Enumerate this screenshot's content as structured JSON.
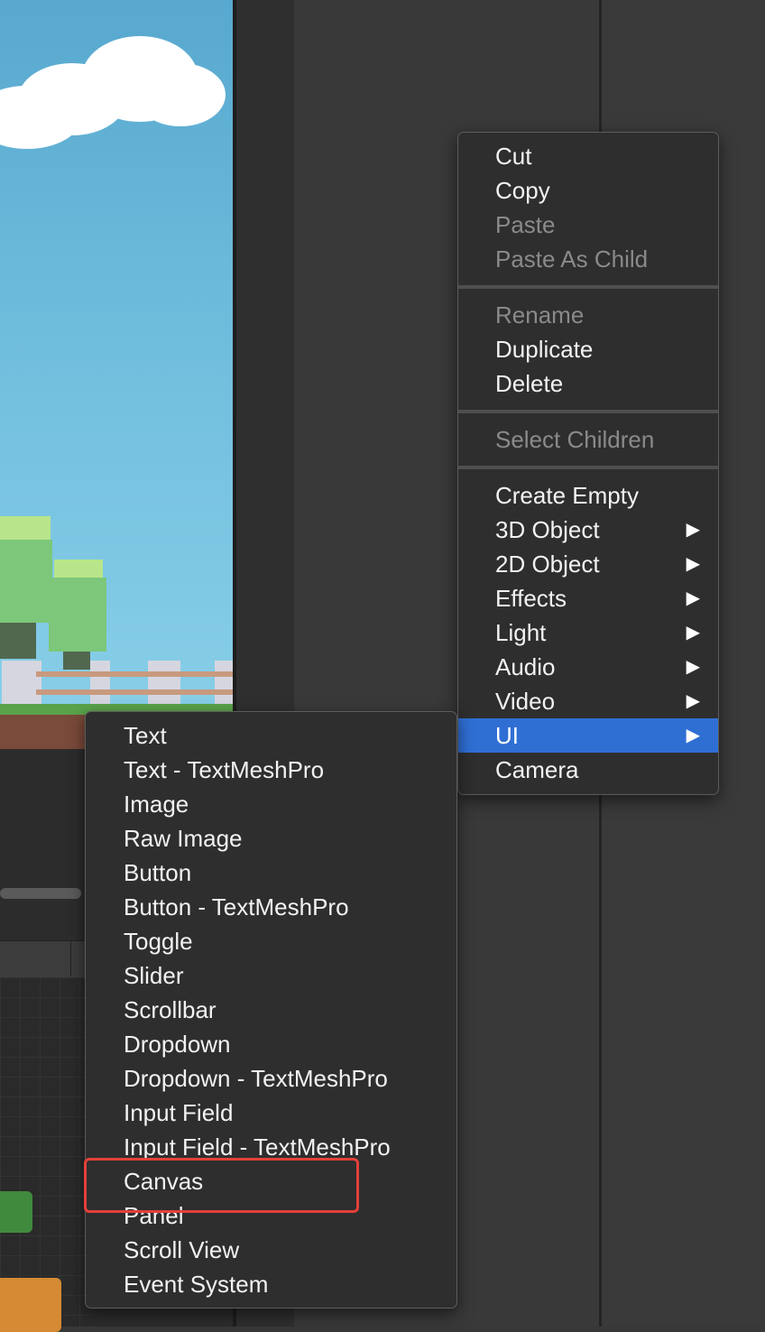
{
  "context_menu": {
    "items": [
      {
        "label": "Cut",
        "enabled": true
      },
      {
        "label": "Copy",
        "enabled": true
      },
      {
        "label": "Paste",
        "enabled": false
      },
      {
        "label": "Paste As Child",
        "enabled": false
      },
      {
        "label": "Rename",
        "enabled": false
      },
      {
        "label": "Duplicate",
        "enabled": true
      },
      {
        "label": "Delete",
        "enabled": true
      },
      {
        "label": "Select Children",
        "enabled": false
      },
      {
        "label": "Create Empty",
        "enabled": true
      },
      {
        "label": "3D Object",
        "enabled": true,
        "has_submenu": true
      },
      {
        "label": "2D Object",
        "enabled": true,
        "has_submenu": true
      },
      {
        "label": "Effects",
        "enabled": true,
        "has_submenu": true
      },
      {
        "label": "Light",
        "enabled": true,
        "has_submenu": true
      },
      {
        "label": "Audio",
        "enabled": true,
        "has_submenu": true
      },
      {
        "label": "Video",
        "enabled": true,
        "has_submenu": true
      },
      {
        "label": "UI",
        "enabled": true,
        "has_submenu": true,
        "selected": true
      },
      {
        "label": "Camera",
        "enabled": true
      }
    ],
    "submenu_arrow": "▶"
  },
  "ui_submenu": {
    "items": [
      "Text",
      "Text - TextMeshPro",
      "Image",
      "Raw Image",
      "Button",
      "Button - TextMeshPro",
      "Toggle",
      "Slider",
      "Scrollbar",
      "Dropdown",
      "Dropdown - TextMeshPro",
      "Input Field",
      "Input Field - TextMeshPro",
      "Canvas",
      "Panel",
      "Scroll View",
      "Event System"
    ],
    "highlighted_item": "Canvas"
  },
  "colors": {
    "menu_bg": "#2e2e2e",
    "selected_bg": "#2f6fd4",
    "highlight_box": "#e4403a",
    "disabled_text": "#8a8a8a"
  }
}
